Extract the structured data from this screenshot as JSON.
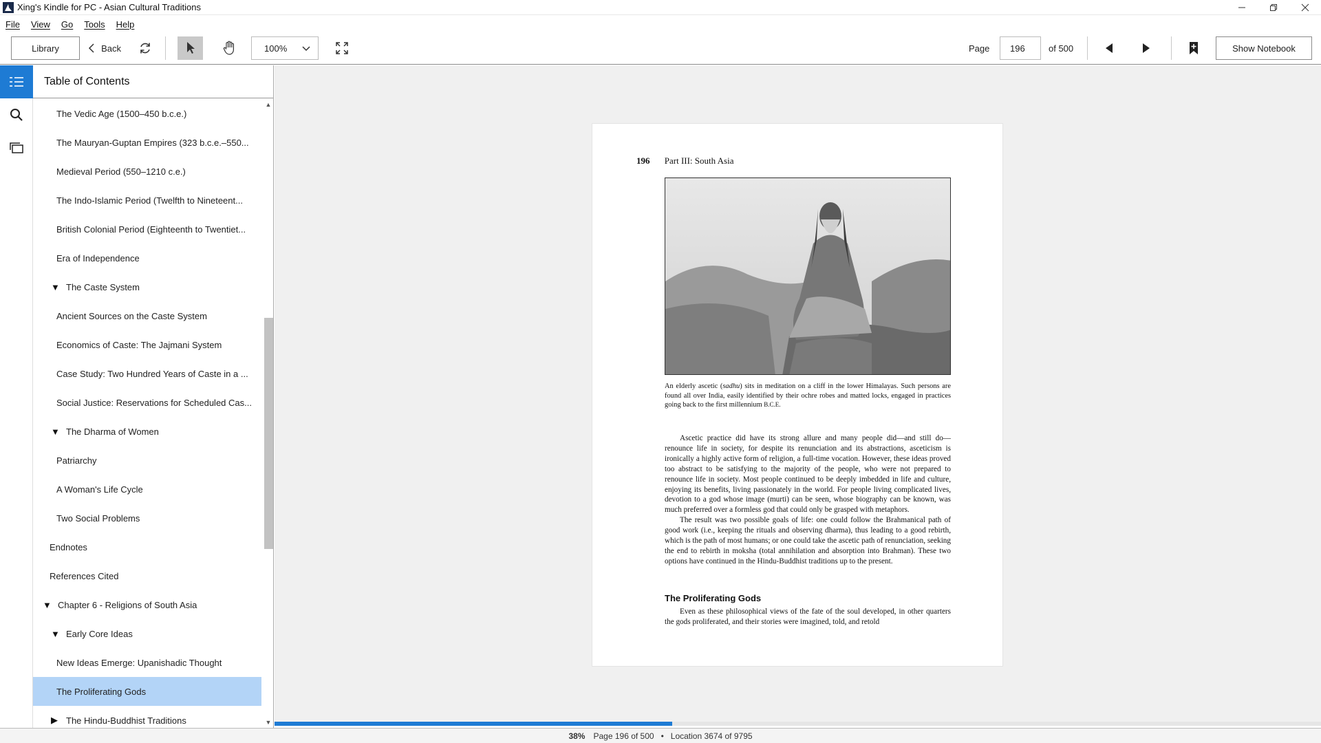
{
  "window": {
    "title": "Xing's Kindle for PC - Asian Cultural Traditions"
  },
  "menu": [
    "File",
    "View",
    "Go",
    "Tools",
    "Help"
  ],
  "toolbar": {
    "library_label": "Library",
    "back_label": "Back",
    "zoom_value": "100%",
    "page_label": "Page",
    "page_value": "196",
    "page_of": "of 500",
    "notebook_label": "Show Notebook"
  },
  "toc": {
    "header": "Table of Contents",
    "items": [
      {
        "label": "The Vedic Age (1500–450 b.c.e.)",
        "level": 2,
        "toggle": ""
      },
      {
        "label": "The Mauryan-Guptan Empires (323 b.c.e.–550...",
        "level": 2,
        "toggle": ""
      },
      {
        "label": "Medieval Period (550–1210 c.e.)",
        "level": 2,
        "toggle": ""
      },
      {
        "label": "The Indo-Islamic Period (Twelfth to Nineteent...",
        "level": 2,
        "toggle": ""
      },
      {
        "label": "British Colonial Period (Eighteenth to Twentiet...",
        "level": 2,
        "toggle": ""
      },
      {
        "label": "Era of Independence",
        "level": 2,
        "toggle": ""
      },
      {
        "label": "The Caste System",
        "level": 1,
        "toggle": "▼"
      },
      {
        "label": "Ancient Sources on the Caste System",
        "level": 2,
        "toggle": ""
      },
      {
        "label": "Economics of Caste: The Jajmani System",
        "level": 2,
        "toggle": ""
      },
      {
        "label": "Case Study: Two Hundred Years of Caste in a ...",
        "level": 2,
        "toggle": ""
      },
      {
        "label": "Social Justice: Reservations for Scheduled Cas...",
        "level": 2,
        "toggle": ""
      },
      {
        "label": "The Dharma of Women",
        "level": 1,
        "toggle": "▼"
      },
      {
        "label": "Patriarchy",
        "level": 2,
        "toggle": ""
      },
      {
        "label": "A Woman's Life Cycle",
        "level": 2,
        "toggle": ""
      },
      {
        "label": "Two Social Problems",
        "level": 2,
        "toggle": ""
      },
      {
        "label": "Endnotes",
        "level": 0,
        "toggle": ""
      },
      {
        "label": "References Cited",
        "level": 0,
        "toggle": ""
      },
      {
        "label": "Chapter 6 - Religions of South Asia",
        "level": 0,
        "toggle": "▼"
      },
      {
        "label": "Early Core Ideas",
        "level": 1,
        "toggle": "▼"
      },
      {
        "label": "New Ideas Emerge: Upanishadic Thought",
        "level": 2,
        "toggle": ""
      },
      {
        "label": "The Proliferating Gods",
        "level": 2,
        "toggle": "",
        "selected": true
      },
      {
        "label": "The Hindu-Buddhist Traditions",
        "level": 1,
        "toggle": "▶"
      }
    ]
  },
  "page": {
    "number": "196",
    "running_head": "Part III: South Asia",
    "caption_parts": [
      "An elderly ascetic (",
      "sadhu",
      ") sits in meditation on a cliff in the lower Himalayas. Such persons are found all over India, easily identified by their ochre robes and matted locks, engaged in practices going back to the first millennium ",
      "B.C.E."
    ],
    "para1": "Ascetic practice did have its strong allure and many people did—and still do—renounce life in society, for despite its renunciation and its abstractions, asceticism is ironically a highly active form of religion, a full-time vocation. However, these ideas proved too abstract to be satisfying to the majority of the people, who were not prepared to renounce life in society. Most people continued to be deeply imbedded in life and culture, enjoying its benefits, living passionately in the world. For people living complicated lives, devotion to a god whose image (murti) can be seen, whose biography can be known, was much preferred over a formless god that could only be grasped with metaphors.",
    "para2": "The result was two possible goals of life: one could follow the Brahmanical path of good work (i.e., keeping the rituals and observing dharma), thus leading to a good rebirth, which is the path of most humans; or one could take the ascetic path of renunciation, seeking the end to rebirth in moksha (total annihilation and absorption into Brahman). These two options have continued in the Hindu-Buddhist traditions up to the present.",
    "section_heading": "The Proliferating Gods",
    "para3": "Even as these philosophical views of the fate of the soul developed, in other quarters the gods proliferated, and their stories were imagined, told, and retold"
  },
  "progress": {
    "fraction": 0.38
  },
  "status": {
    "percent": "38%",
    "page_info": "Page 196 of 500",
    "location": "Location 3674 of 9795"
  },
  "colors": {
    "accent": "#1e7bd4",
    "selected_row": "#b3d4f7"
  }
}
